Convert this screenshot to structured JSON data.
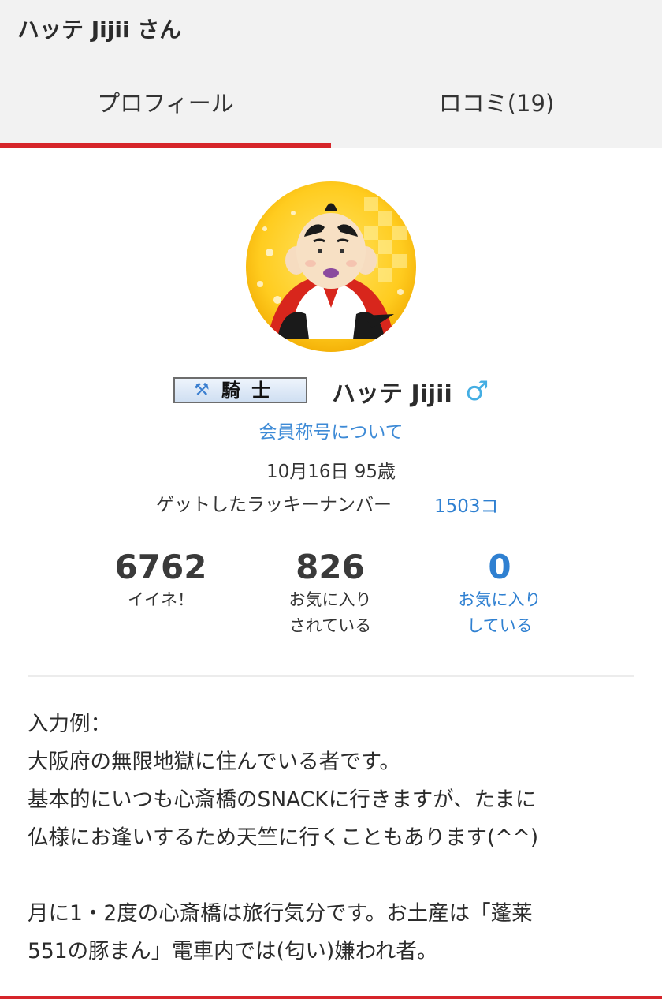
{
  "header": {
    "title": "ハッテ Jijii さん"
  },
  "tabs": [
    {
      "label": "プロフィール",
      "active": true
    },
    {
      "label": "ロコミ(19)",
      "active": false
    }
  ],
  "profile": {
    "rank_badge": "騎士",
    "rank_icon": "crossed-axes-icon",
    "name": "ハッテ Jijii",
    "gender_symbol": "♂",
    "rank_link": "会員称号について",
    "birthday": "10月16日 95歳",
    "lucky_label": "ゲットしたラッキーナンバー",
    "lucky_value": "1503コ"
  },
  "stats": [
    {
      "value": "6762",
      "label": "イイネ！"
    },
    {
      "value": "826",
      "label": "お気に入り\nされている"
    },
    {
      "value": "0",
      "label": "お気に入り\nしている"
    }
  ],
  "bio": {
    "lines": [
      "入力例：",
      "大阪府の無限地獄に住んでいる者です。",
      "基本的にいつも心斎橋のSNACKに行きますが、たまに",
      "仏様にお逢いするため天竺に行くこともあります(^^)",
      "",
      "月に1・2度の心斎橋は旅行気分です。お土産は「蓬莱",
      "551の豚まん」電車内では(匂い)嫌われ者。"
    ]
  },
  "colors": {
    "accent": "#d6252a",
    "link": "#2f80d1",
    "gender": "#45aee3",
    "header_bg": "#f2f2f2"
  }
}
